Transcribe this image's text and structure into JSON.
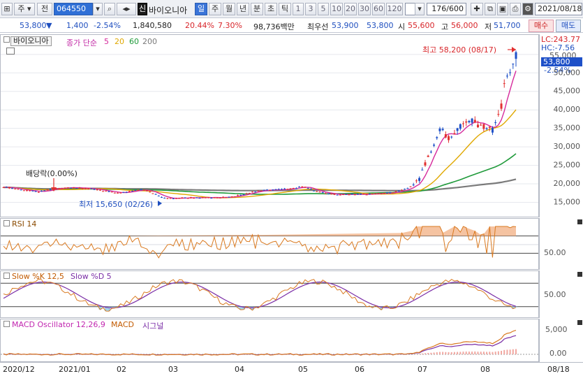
{
  "toolbar": {
    "market": "주",
    "trade_type": "전",
    "code": "064550",
    "name_badge": "신",
    "name": "바이오니아",
    "period_tabs": [
      "일",
      "주",
      "월",
      "년",
      "분",
      "초",
      "틱"
    ],
    "minute_buttons": [
      "1",
      "3",
      "5",
      "10",
      "20",
      "30",
      "60",
      "120"
    ],
    "count": "176/600",
    "date": "2021/08/18"
  },
  "quote": {
    "price": "53,800",
    "direction": "▼",
    "change": "1,400",
    "change_pct": "-2.54%",
    "volume": "1,840,580",
    "turnover_ratio": "20.44%",
    "ratio2": "7.30%",
    "amount": "98,736백만",
    "best_label": "최우선",
    "ask": "53,900",
    "bid": "53,800",
    "open_label": "시",
    "open": "55,600",
    "high_label": "고",
    "high": "56,000",
    "low_label": "저",
    "low": "51,700",
    "buy_button": "매수",
    "sell_button": "매도"
  },
  "price_panel": {
    "name": "바이오니아",
    "ma_label": "종가 단순",
    "ma_periods": [
      "5",
      "20",
      "60",
      "200"
    ],
    "ma_colors": [
      "#d62a9c",
      "#e0a800",
      "#1f9a3a",
      "#7a7a7a"
    ],
    "dividend": "배당락(0.00%)",
    "high_note": "최고 58,200 (08/17)",
    "low_note": "최저 15,650 (02/26)",
    "lc": "LC:243.77",
    "hc": "HC:-7.56",
    "last_price": "53,800",
    "last_pct": "-2.54%",
    "top_tick": "55,000"
  },
  "rsi_panel": {
    "label": "RSI 14",
    "tick": "50.00"
  },
  "stoch_panel": {
    "label_k": "Slow %K 12,5",
    "label_d": "Slow %D 5",
    "tick": "50.00"
  },
  "macd_panel": {
    "label_osc": "MACD Oscillator 12,26,9",
    "label_macd": "MACD",
    "label_sig": "시그널",
    "ticks": [
      "5,000",
      "0.00"
    ]
  },
  "x_axis": {
    "labels": [
      "2020/12",
      "2021/01",
      "02",
      "03",
      "04",
      "05",
      "06",
      "07",
      "08",
      "08/18"
    ]
  },
  "colors": {
    "up": "#e23030",
    "down": "#1e50c8",
    "accent": "#2f6fd6"
  },
  "chart_data": {
    "type": "candlestick",
    "title": "바이오니아",
    "x_range": [
      "2020/12",
      "2021/08/18"
    ],
    "price_axis": {
      "ticks": [
        15000,
        20000,
        25000,
        30000,
        35000,
        40000,
        45000,
        50000,
        55000
      ],
      "ylim": [
        11500,
        59500
      ]
    },
    "monthly_closes": {
      "x": [
        "2020/12",
        "2021/01",
        "02",
        "03",
        "04",
        "05",
        "06",
        "07",
        "08"
      ],
      "values": [
        19000,
        18500,
        17400,
        16000,
        18000,
        19000,
        17500,
        30000,
        45000
      ]
    },
    "last": {
      "open": 55600,
      "high": 56000,
      "low": 51700,
      "close": 53800
    },
    "period_high": {
      "value": 58200,
      "date": "08/17"
    },
    "period_low": {
      "value": 15650,
      "date": "02/26"
    },
    "rsi": {
      "reference": 50
    },
    "stochastic": {
      "reference": 50
    },
    "macd": {
      "ticks": [
        5000,
        0
      ]
    }
  }
}
